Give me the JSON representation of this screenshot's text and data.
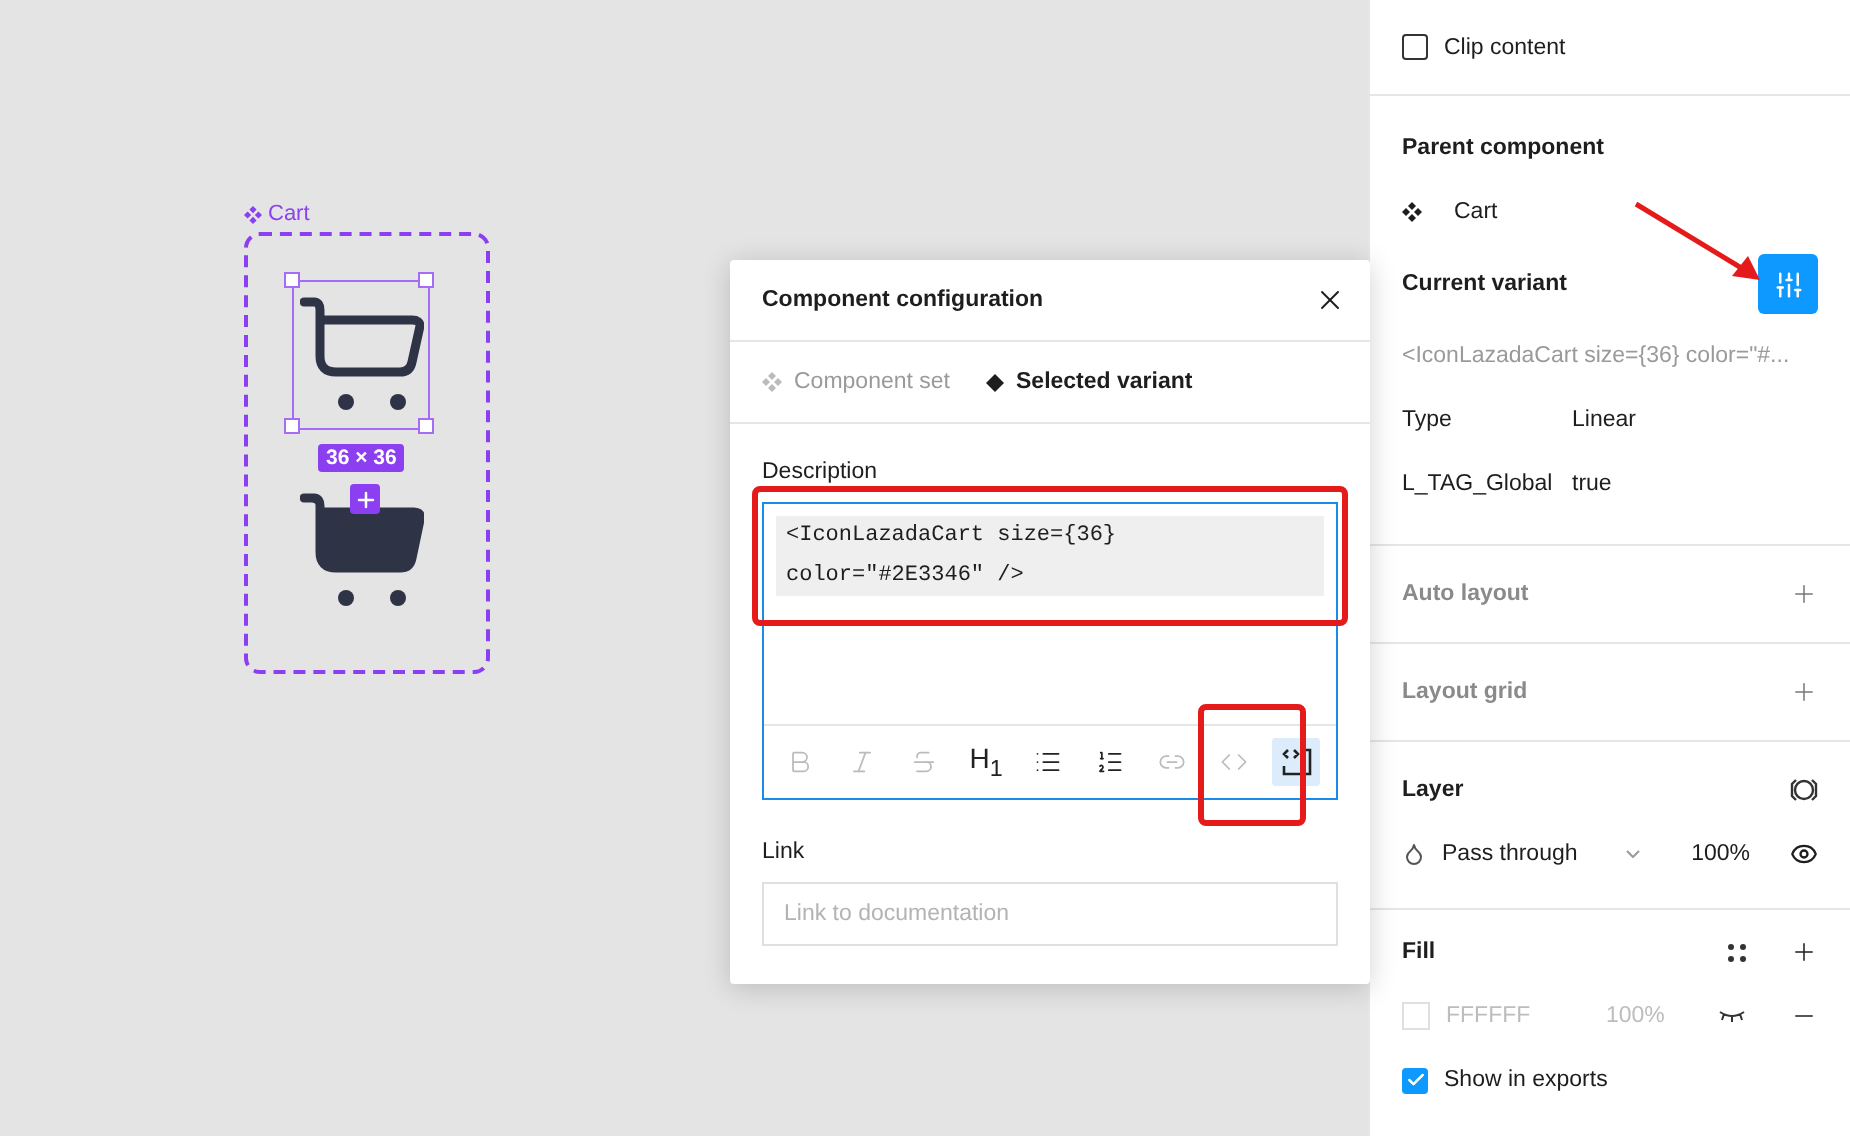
{
  "canvas": {
    "frame_label": "Cart",
    "size_badge": "36 × 36"
  },
  "dialog": {
    "title": "Component configuration",
    "tabs": [
      {
        "label": "Component set",
        "selected": false
      },
      {
        "label": "Selected variant",
        "selected": true
      }
    ],
    "description": {
      "label": "Description",
      "code_lines": [
        "<IconLazadaCart size={36}",
        "color=\"#2E3346\" />"
      ]
    },
    "tools": [
      {
        "kind": "bold",
        "enabled": false,
        "selected": false
      },
      {
        "kind": "italic",
        "enabled": false,
        "selected": false
      },
      {
        "kind": "strike",
        "enabled": false,
        "selected": false
      },
      {
        "kind": "heading",
        "label": "H$_{1}$",
        "enabled": true,
        "selected": false
      },
      {
        "kind": "bullets",
        "enabled": true,
        "selected": false
      },
      {
        "kind": "numbers",
        "enabled": true,
        "selected": false
      },
      {
        "kind": "link",
        "enabled": false,
        "selected": false
      },
      {
        "kind": "code",
        "enabled": false,
        "selected": false
      },
      {
        "kind": "code_block",
        "enabled": true,
        "selected": true
      }
    ],
    "link": {
      "label": "Link",
      "placeholder": "Link to documentation"
    }
  },
  "panel": {
    "clip_content": {
      "label": "Clip content",
      "checked": false
    },
    "parent_component": {
      "title": "Parent component",
      "name": "Cart"
    },
    "current_variant": {
      "title": "Current variant",
      "description": "<IconLazadaCart size={36} color=\"#...",
      "properties": [
        {
          "name": "Type",
          "value": "Linear"
        },
        {
          "name": "L_TAG_Global",
          "value": "true"
        }
      ]
    },
    "auto_layout": {
      "title": "Auto layout"
    },
    "layout_grid": {
      "title": "Layout grid"
    },
    "layer": {
      "title": "Layer",
      "blend": "Pass through",
      "opacity": "100%"
    },
    "fill": {
      "title": "Fill",
      "color": "FFFFFF",
      "opacity": "100%",
      "show_in_exports": {
        "label": "Show in exports",
        "checked": true
      }
    }
  }
}
